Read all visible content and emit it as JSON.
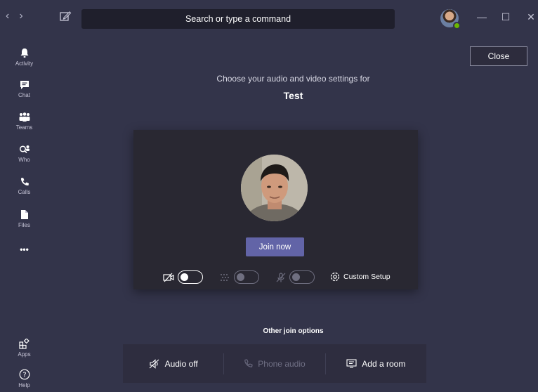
{
  "titlebar": {
    "search_placeholder": "Search or type a command",
    "back_icon": "chevron-left-icon",
    "forward_icon": "chevron-right-icon",
    "compose_icon": "compose-icon",
    "minimize_glyph": "—",
    "maximize_glyph": "☐",
    "close_glyph": "✕"
  },
  "rail": {
    "items": [
      {
        "label": "Activity",
        "icon": "bell-icon"
      },
      {
        "label": "Chat",
        "icon": "chat-icon"
      },
      {
        "label": "Teams",
        "icon": "teams-icon"
      },
      {
        "label": "Who",
        "icon": "who-icon"
      },
      {
        "label": "Calls",
        "icon": "phone-icon"
      },
      {
        "label": "Files",
        "icon": "file-icon"
      }
    ],
    "more_label": "•••",
    "apps_label": "Apps",
    "help_label": "Help"
  },
  "main": {
    "close_label": "Close",
    "subtitle": "Choose your audio and video settings for",
    "meeting_name": "Test",
    "join_label": "Join now",
    "custom_setup_label": "Custom Setup",
    "toggles": {
      "camera": "off",
      "blur": "disabled",
      "mic": "disabled"
    },
    "other_title": "Other join options",
    "options": [
      {
        "label": "Audio off",
        "icon": "speaker-off-icon",
        "enabled": true
      },
      {
        "label": "Phone audio",
        "icon": "phone-icon",
        "enabled": false
      },
      {
        "label": "Add a room",
        "icon": "cast-icon",
        "enabled": true
      }
    ]
  },
  "colors": {
    "background": "#33344a",
    "accent": "#6264a7",
    "panel": "#292832",
    "presence": "#6bb700"
  }
}
